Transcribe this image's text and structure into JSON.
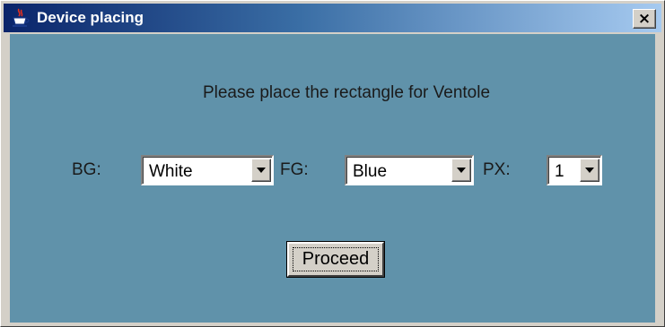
{
  "window": {
    "title": "Device placing",
    "close_label": "×"
  },
  "dialog": {
    "prompt": "Please place the rectangle for Ventole",
    "bg": {
      "label": "BG:",
      "value": "White"
    },
    "fg": {
      "label": "FG:",
      "value": "Blue"
    },
    "px": {
      "label": "PX:",
      "value": "1"
    },
    "proceed_label": "Proceed"
  },
  "icons": {
    "title_icon": "java-cup-icon",
    "dropdown_icon": "chevron-down-icon"
  },
  "colors": {
    "titlebar_start": "#0a246a",
    "titlebar_end": "#a6caf0",
    "content_bg": "#6092aa",
    "window_bg": "#d4d0c8"
  }
}
